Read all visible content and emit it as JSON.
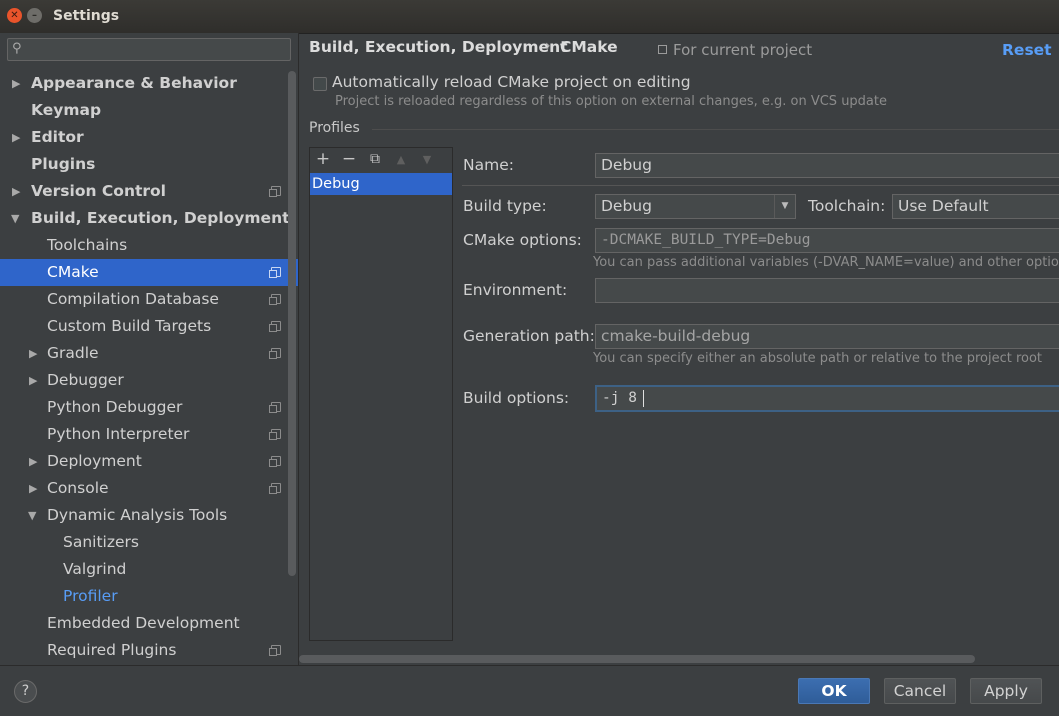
{
  "window": {
    "title": "Settings"
  },
  "search": {
    "placeholder": ""
  },
  "sidebar": {
    "items": [
      {
        "label": "Appearance & Behavior"
      },
      {
        "label": "Keymap"
      },
      {
        "label": "Editor"
      },
      {
        "label": "Plugins"
      },
      {
        "label": "Version Control"
      },
      {
        "label": "Build, Execution, Deployment"
      },
      {
        "label": "Toolchains"
      },
      {
        "label": "CMake"
      },
      {
        "label": "Compilation Database"
      },
      {
        "label": "Custom Build Targets"
      },
      {
        "label": "Gradle"
      },
      {
        "label": "Debugger"
      },
      {
        "label": "Python Debugger"
      },
      {
        "label": "Python Interpreter"
      },
      {
        "label": "Deployment"
      },
      {
        "label": "Console"
      },
      {
        "label": "Dynamic Analysis Tools"
      },
      {
        "label": "Sanitizers"
      },
      {
        "label": "Valgrind"
      },
      {
        "label": "Profiler"
      },
      {
        "label": "Embedded Development"
      },
      {
        "label": "Required Plugins"
      }
    ]
  },
  "header": {
    "crumb_parent": "Build, Execution, Deployment",
    "crumb_sep": "›",
    "crumb_current": "CMake",
    "for_current_project": "For current project",
    "reset": "Reset"
  },
  "auto_reload": {
    "label": "Automatically reload CMake project on editing",
    "hint": "Project is reloaded regardless of this option on external changes, e.g. on VCS update",
    "checked": false
  },
  "profiles": {
    "label": "Profiles",
    "toolbar": {
      "add": "+",
      "remove": "−",
      "copy": "⧉",
      "up": "▲",
      "down": "▼"
    },
    "items": [
      "Debug"
    ]
  },
  "form": {
    "name_label": "Name:",
    "name_value": "Debug",
    "build_type_label": "Build type:",
    "build_type_value": "Debug",
    "toolchain_label": "Toolchain:",
    "toolchain_value": "Use Default",
    "cmake_options_label": "CMake options:",
    "cmake_options_value": "-DCMAKE_BUILD_TYPE=Debug",
    "cmake_options_hint": "You can pass additional variables (-DVAR_NAME=value) and other options",
    "environment_label": "Environment:",
    "environment_value": "",
    "generation_path_label": "Generation path:",
    "generation_path_value": "cmake-build-debug",
    "generation_path_hint": "You can specify either an absolute path or relative to the project root",
    "build_options_label": "Build options:",
    "build_options_value": "-j 8"
  },
  "footer": {
    "help": "?",
    "ok": "OK",
    "cancel": "Cancel",
    "apply": "Apply"
  }
}
